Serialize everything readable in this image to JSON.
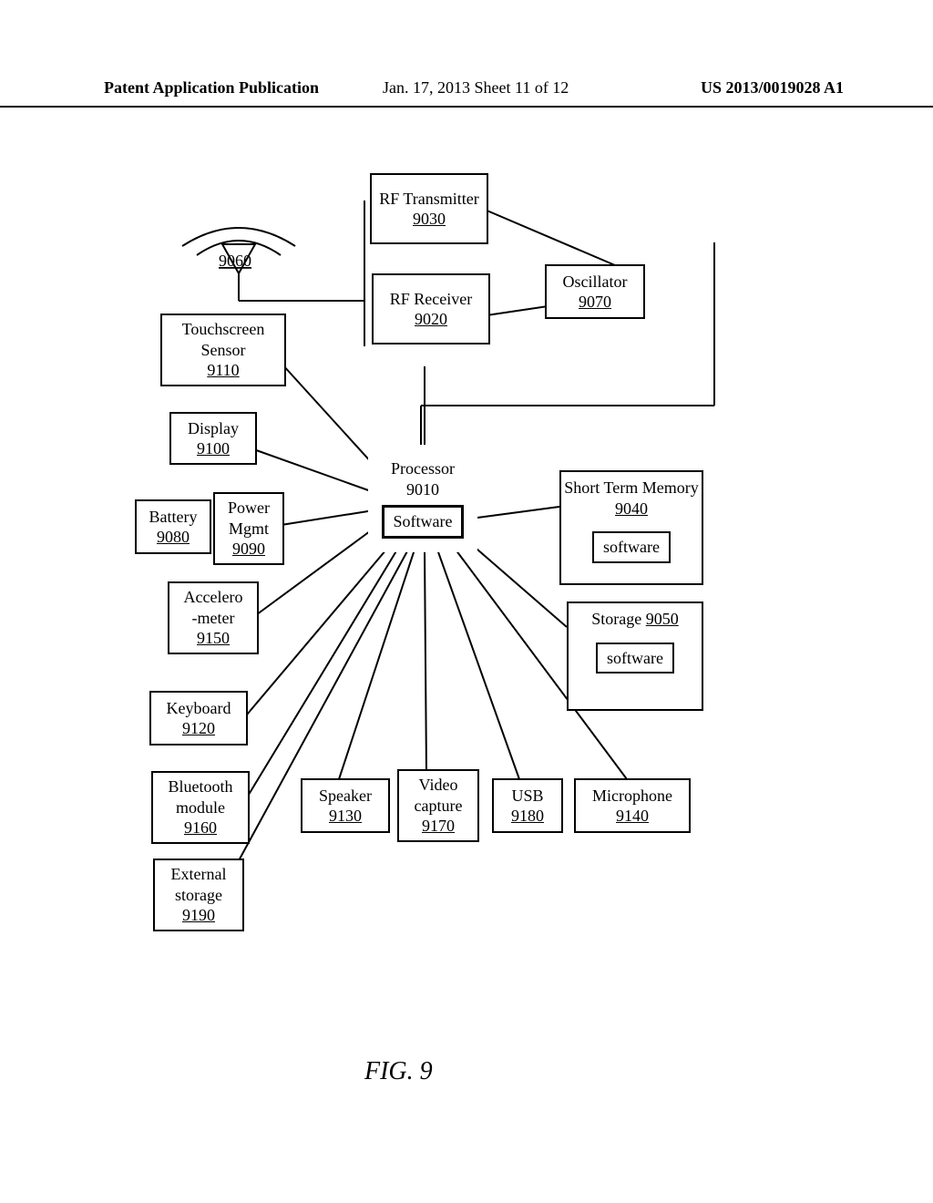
{
  "header": {
    "left": "Patent Application Publication",
    "mid": "Jan. 17, 2013  Sheet 11 of 12",
    "right": "US 2013/0019028 A1"
  },
  "figure_label": "FIG. 9",
  "antenna_ref": "9060",
  "blocks": {
    "rf_transmitter": {
      "title": "RF Transmitter",
      "ref": "9030"
    },
    "rf_receiver": {
      "title": "RF Receiver",
      "ref": "9020"
    },
    "oscillator": {
      "title": "Oscillator",
      "ref": "9070"
    },
    "touchscreen": {
      "title": "Touchscreen Sensor",
      "ref": "9110"
    },
    "display": {
      "title": "Display",
      "ref": "9100"
    },
    "battery": {
      "title": "Battery",
      "ref": "9080"
    },
    "power_mgmt": {
      "title": "Power Mgmt",
      "ref": "9090"
    },
    "accelerometer": {
      "title_line1": "Accelero",
      "title_line2": "-meter",
      "ref": "9150"
    },
    "keyboard": {
      "title": "Keyboard",
      "ref": "9120"
    },
    "bluetooth": {
      "title": "Bluetooth module",
      "ref": "9160"
    },
    "external_storage": {
      "title": "External storage",
      "ref": "9190"
    },
    "speaker": {
      "title": "Speaker",
      "ref": "9130"
    },
    "video_capture": {
      "title": "Video capture",
      "ref": "9170"
    },
    "usb": {
      "title": "USB",
      "ref": "9180"
    },
    "microphone": {
      "title": "Microphone",
      "ref": "9140"
    },
    "processor": {
      "title": "Processor",
      "ref": "9010",
      "inner": "Software"
    },
    "short_term_memory": {
      "title": "Short Term Memory",
      "ref": "9040",
      "inner": "software"
    },
    "storage": {
      "title": "Storage",
      "ref": "9050",
      "inner": "software"
    }
  }
}
